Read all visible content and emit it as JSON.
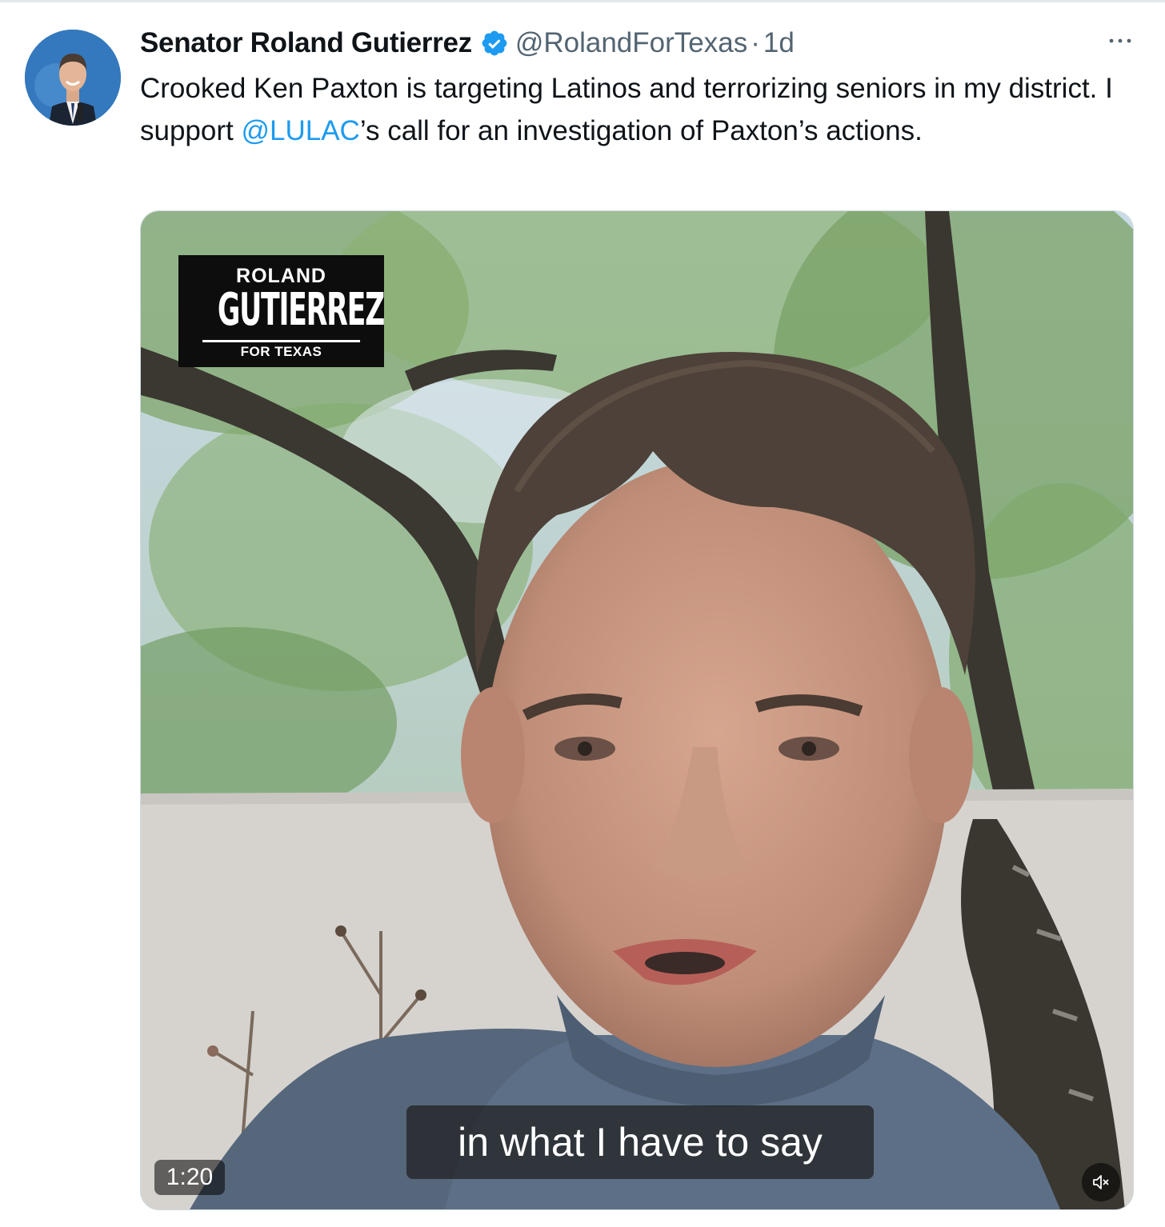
{
  "tweet": {
    "author_display_name": "Senator Roland Gutierrez",
    "author_handle": "@RolandForTexas",
    "separator": "·",
    "age": "1d",
    "text_before_mention": "Crooked Ken Paxton is targeting Latinos and terrorizing seniors in my district. I support ",
    "mention": "@LULAC",
    "text_after_mention": "’s call for an investigation of Paxton’s actions."
  },
  "video": {
    "logo_line1": "ROLAND",
    "logo_line2": "GUTIERREZ",
    "logo_line3": "FOR TEXAS",
    "caption": "in what I have to say",
    "duration": "1:20",
    "muted": true
  },
  "icons": {
    "verified": "verified-badge-icon",
    "more": "more-options-icon",
    "mute": "speaker-muted-icon"
  },
  "colors": {
    "text": "#0f1419",
    "secondary": "#536471",
    "link": "#1d9bf0",
    "verified": "#1d9bf0"
  }
}
